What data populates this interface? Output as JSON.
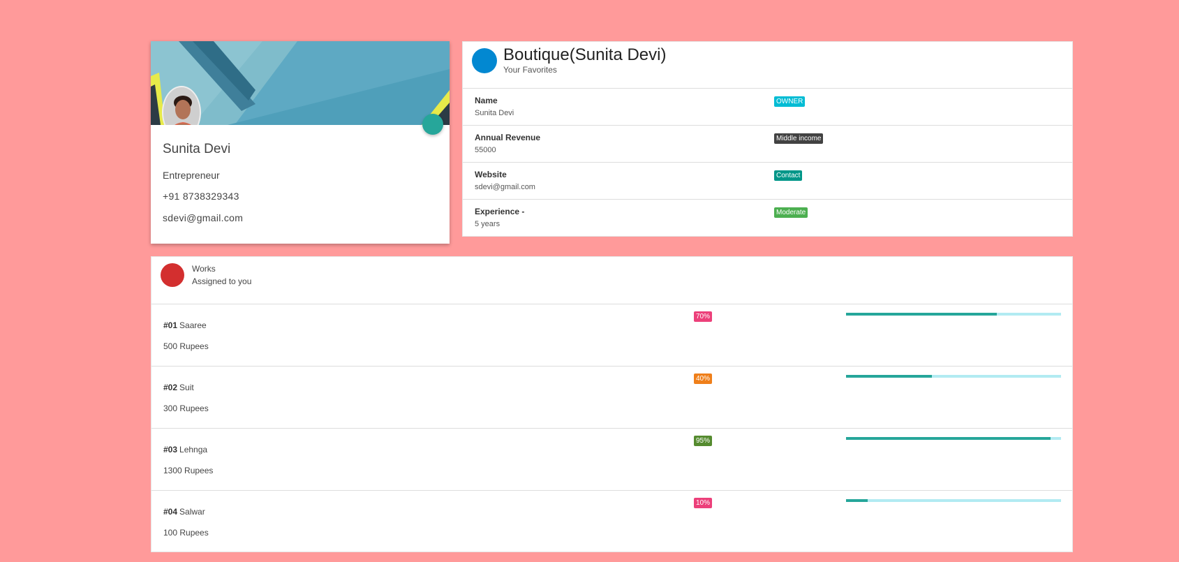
{
  "profile": {
    "name": "Sunita Devi",
    "occupation": "Entrepreneur",
    "phone": "+91 8738329343",
    "email": "sdevi@gmail.com"
  },
  "business": {
    "title": "Boutique(Sunita Devi)",
    "subtitle": "Your Favorites",
    "rows": [
      {
        "label": "Name",
        "value": "Sunita Devi",
        "badge": "OWNER",
        "badge_color": "#00bcd4"
      },
      {
        "label": "Annual Revenue",
        "value": "55000",
        "badge": "Middle income",
        "badge_color": "#424242"
      },
      {
        "label": "Website",
        "value": "sdevi@gmail.com",
        "badge": "Contact",
        "badge_color": "#009688"
      },
      {
        "label": "Experience -",
        "value": "5 years",
        "badge": "Moderate",
        "badge_color": "#4caf50"
      }
    ]
  },
  "works": {
    "title": "Works",
    "subtitle": "Assigned to you",
    "items": [
      {
        "number": "#01",
        "name": "Saaree",
        "price": "500 Rupees",
        "percent_label": "70%",
        "progress": 70,
        "badge_color": "#ec407a"
      },
      {
        "number": "#02",
        "name": "Suit",
        "price": "300 Rupees",
        "percent_label": "40%",
        "progress": 40,
        "badge_color": "#ef7f1a"
      },
      {
        "number": "#03",
        "name": "Lehnga",
        "price": "1300 Rupees",
        "percent_label": "95%",
        "progress": 95,
        "badge_color": "#558b2f"
      },
      {
        "number": "#04",
        "name": "Salwar",
        "price": "100 Rupees",
        "percent_label": "10%",
        "progress": 10,
        "badge_color": "#ec407a"
      }
    ]
  },
  "colors": {
    "background": "#ff9a9a",
    "business_dot": "#0288d1",
    "works_dot": "#d32f2f",
    "fab": "#26a69a",
    "progress_fill": "#26a69a",
    "progress_track": "#b2ebf2"
  }
}
